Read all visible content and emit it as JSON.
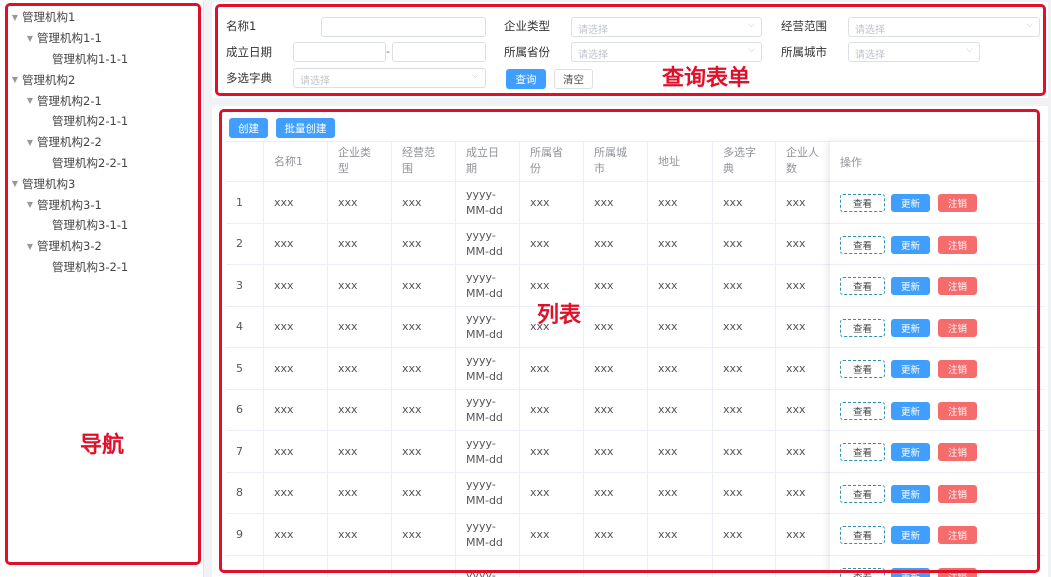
{
  "nav": {
    "tree": [
      {
        "label": "管理机构1",
        "level": 0,
        "expandable": true
      },
      {
        "label": "管理机构1-1",
        "level": 1,
        "expandable": true
      },
      {
        "label": "管理机构1-1-1",
        "level": 2,
        "expandable": false
      },
      {
        "label": "管理机构2",
        "level": 0,
        "expandable": true
      },
      {
        "label": "管理机构2-1",
        "level": 1,
        "expandable": true
      },
      {
        "label": "管理机构2-1-1",
        "level": 2,
        "expandable": false
      },
      {
        "label": "管理机构2-2",
        "level": 1,
        "expandable": true
      },
      {
        "label": "管理机构2-2-1",
        "level": 2,
        "expandable": false
      },
      {
        "label": "管理机构3",
        "level": 0,
        "expandable": true
      },
      {
        "label": "管理机构3-1",
        "level": 1,
        "expandable": true
      },
      {
        "label": "管理机构3-1-1",
        "level": 2,
        "expandable": false
      },
      {
        "label": "管理机构3-2",
        "level": 1,
        "expandable": true
      },
      {
        "label": "管理机构3-2-1",
        "level": 2,
        "expandable": false
      }
    ],
    "annotation": "导航"
  },
  "query": {
    "annotation": "查询表单",
    "name_label": "名称1",
    "company_type_label": "企业类型",
    "company_type_placeholder": "请选择",
    "business_scope_label": "经营范围",
    "business_scope_placeholder": "请选择",
    "founded_label": "成立日期",
    "date_separator": "-",
    "province_label": "所属省份",
    "province_placeholder": "请选择",
    "city_label": "所属城市",
    "city_placeholder": "请选择",
    "multi_dict_label": "多选字典",
    "multi_dict_placeholder": "请选择",
    "search_button": "查询",
    "clear_button": "清空"
  },
  "list": {
    "annotation": "列表",
    "create_button": "创建",
    "batch_create_button": "批量创建",
    "columns": [
      "",
      "名称1",
      "企业类\n型",
      "经营范\n围",
      "成立日\n期",
      "所属省\n份",
      "所属城\n市",
      "地址",
      "多选字\n典",
      "企业人\n数"
    ],
    "op_column": "操作",
    "rows": [
      [
        "1",
        "xxx",
        "xxx",
        "xxx",
        "yyyy-\nMM-dd",
        "xxx",
        "xxx",
        "xxx",
        "xxx",
        "xxx"
      ],
      [
        "2",
        "xxx",
        "xxx",
        "xxx",
        "yyyy-\nMM-dd",
        "xxx",
        "xxx",
        "xxx",
        "xxx",
        "xxx"
      ],
      [
        "3",
        "xxx",
        "xxx",
        "xxx",
        "yyyy-\nMM-dd",
        "xxx",
        "xxx",
        "xxx",
        "xxx",
        "xxx"
      ],
      [
        "4",
        "xxx",
        "xxx",
        "xxx",
        "yyyy-\nMM-dd",
        "xxx",
        "xxx",
        "xxx",
        "xxx",
        "xxx"
      ],
      [
        "5",
        "xxx",
        "xxx",
        "xxx",
        "yyyy-\nMM-dd",
        "xxx",
        "xxx",
        "xxx",
        "xxx",
        "xxx"
      ],
      [
        "6",
        "xxx",
        "xxx",
        "xxx",
        "yyyy-\nMM-dd",
        "xxx",
        "xxx",
        "xxx",
        "xxx",
        "xxx"
      ],
      [
        "7",
        "xxx",
        "xxx",
        "xxx",
        "yyyy-\nMM-dd",
        "xxx",
        "xxx",
        "xxx",
        "xxx",
        "xxx"
      ],
      [
        "8",
        "xxx",
        "xxx",
        "xxx",
        "yyyy-\nMM-dd",
        "xxx",
        "xxx",
        "xxx",
        "xxx",
        "xxx"
      ],
      [
        "9",
        "xxx",
        "xxx",
        "xxx",
        "yyyy-\nMM-dd",
        "xxx",
        "xxx",
        "xxx",
        "xxx",
        "xxx"
      ],
      [
        "",
        "",
        "",
        "",
        "yyyy-",
        "",
        "",
        "",
        "",
        ""
      ]
    ],
    "view_button": "查看",
    "update_button": "更新",
    "cancel_button": "注销"
  },
  "colors": {
    "annotation_red": "#e0102a",
    "primary": "#409eff",
    "danger": "#f56c6c"
  }
}
